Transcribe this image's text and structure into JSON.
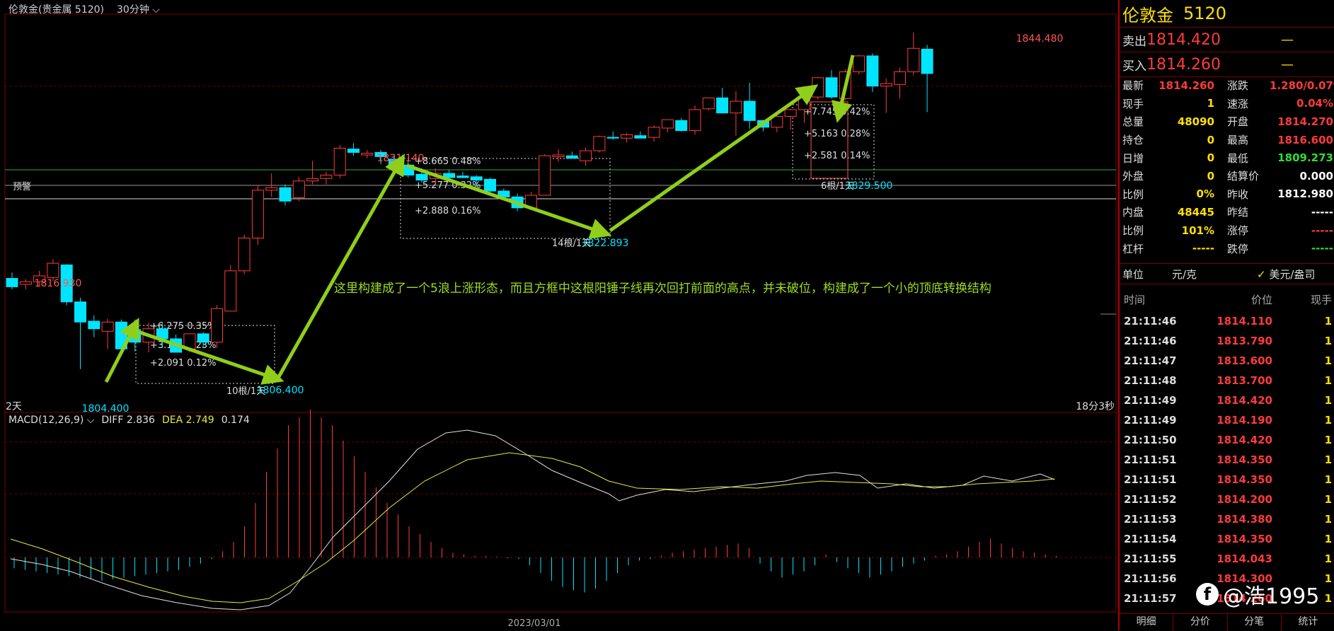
{
  "header": {
    "title": "伦敦金(贵金属 5120)",
    "interval": "30分钟"
  },
  "chart_data": {
    "type": "candlestick",
    "x_label": "2023/03/01",
    "duration_left": "2天",
    "duration_right": "18分3秒",
    "alert_label": "预警",
    "ylim": [
      1800.5,
      1846.5
    ],
    "candles": [
      [
        1815.2,
        1815.9,
        1813.9,
        1814.2
      ],
      [
        1814.5,
        1815.1,
        1813.9,
        1814.8
      ],
      [
        1814.8,
        1816.1,
        1814.2,
        1815.5
      ],
      [
        1815.3,
        1817.5,
        1814.9,
        1817.0
      ],
      [
        1816.8,
        1816.9,
        1812.0,
        1812.4
      ],
      [
        1812.4,
        1812.9,
        1804.4,
        1810.0
      ],
      [
        1810.1,
        1810.8,
        1808.2,
        1809.2
      ],
      [
        1808.9,
        1810.4,
        1806.8,
        1810.0
      ],
      [
        1810.0,
        1810.3,
        1806.5,
        1806.8
      ],
      [
        1809.1,
        1810.3,
        1806.5,
        1807.6
      ],
      [
        1807.6,
        1809.9,
        1806.4,
        1809.2
      ],
      [
        1809.2,
        1809.9,
        1806.9,
        1808.0
      ],
      [
        1808.0,
        1808.5,
        1806.4,
        1806.4
      ],
      [
        1806.8,
        1808.6,
        1806.4,
        1808.6
      ],
      [
        1808.6,
        1808.8,
        1806.9,
        1807.6
      ],
      [
        1807.6,
        1812.0,
        1806.9,
        1811.6
      ],
      [
        1811.3,
        1816.8,
        1811.3,
        1816.1
      ],
      [
        1816.1,
        1820.4,
        1815.7,
        1820.0
      ],
      [
        1820.0,
        1826.3,
        1819.2,
        1825.7
      ],
      [
        1825.7,
        1827.7,
        1824.9,
        1826.0
      ],
      [
        1826.0,
        1826.4,
        1823.9,
        1824.4
      ],
      [
        1824.8,
        1827.3,
        1824.4,
        1826.8
      ],
      [
        1826.8,
        1829.2,
        1826.4,
        1827.1
      ],
      [
        1827.1,
        1827.9,
        1826.4,
        1827.5
      ],
      [
        1827.5,
        1831.1,
        1827.1,
        1830.7
      ],
      [
        1830.6,
        1831.3,
        1829.8,
        1830.2
      ],
      [
        1829.9,
        1830.5,
        1829.5,
        1830.1
      ],
      [
        1830.2,
        1830.5,
        1828.8,
        1829.7
      ],
      [
        1829.4,
        1830.0,
        1828.6,
        1828.7
      ],
      [
        1828.7,
        1829.3,
        1827.2,
        1827.5
      ],
      [
        1827.6,
        1828.3,
        1826.6,
        1826.9
      ],
      [
        1827.1,
        1828.3,
        1826.3,
        1827.7
      ],
      [
        1827.7,
        1828.1,
        1826.6,
        1827.2
      ],
      [
        1827.4,
        1827.9,
        1827.2,
        1827.2
      ],
      [
        1827.3,
        1827.5,
        1826.1,
        1826.9
      ],
      [
        1827.0,
        1827.2,
        1825.4,
        1825.6
      ],
      [
        1825.6,
        1825.9,
        1824.8,
        1824.9
      ],
      [
        1824.9,
        1825.3,
        1823.2,
        1823.6
      ],
      [
        1823.6,
        1825.5,
        1823.6,
        1825.1
      ],
      [
        1825.1,
        1830.0,
        1825.1,
        1829.8
      ],
      [
        1829.7,
        1830.6,
        1829.1,
        1829.9
      ],
      [
        1829.8,
        1830.3,
        1829.5,
        1829.5
      ],
      [
        1829.2,
        1830.8,
        1828.6,
        1830.4
      ],
      [
        1830.4,
        1832.2,
        1830.2,
        1832.1
      ],
      [
        1832.0,
        1832.7,
        1831.7,
        1831.9
      ],
      [
        1831.9,
        1832.5,
        1831.4,
        1832.3
      ],
      [
        1832.2,
        1832.7,
        1831.9,
        1831.9
      ],
      [
        1832.0,
        1833.4,
        1831.5,
        1833.2
      ],
      [
        1833.1,
        1834.1,
        1832.6,
        1834.1
      ],
      [
        1834.0,
        1834.3,
        1832.7,
        1832.8
      ],
      [
        1832.8,
        1835.8,
        1832.3,
        1835.3
      ],
      [
        1835.4,
        1836.7,
        1835.2,
        1836.7
      ],
      [
        1836.7,
        1837.9,
        1834.9,
        1834.9
      ],
      [
        1834.9,
        1837.5,
        1832.2,
        1836.3
      ],
      [
        1836.3,
        1838.5,
        1833.0,
        1834.0
      ],
      [
        1834.0,
        1834.1,
        1832.7,
        1833.2
      ],
      [
        1833.2,
        1835.0,
        1832.6,
        1834.5
      ],
      [
        1834.5,
        1835.4,
        1832.9,
        1835.3
      ],
      [
        1835.3,
        1836.9,
        1833.7,
        1836.8
      ],
      [
        1836.8,
        1839.2,
        1836.5,
        1839.1
      ],
      [
        1839.1,
        1840.0,
        1836.6,
        1836.8
      ],
      [
        1836.6,
        1840.1,
        1836.4,
        1839.8
      ],
      [
        1839.8,
        1841.8,
        1839.5,
        1841.7
      ],
      [
        1841.7,
        1842.0,
        1837.4,
        1838.1
      ],
      [
        1838.1,
        1839.0,
        1834.9,
        1838.4
      ],
      [
        1838.3,
        1840.3,
        1836.6,
        1839.8
      ],
      [
        1839.8,
        1844.5,
        1839.4,
        1842.6
      ],
      [
        1842.5,
        1843.0,
        1835.0,
        1839.6
      ]
    ],
    "price_labels": {
      "high_1": "1816.930",
      "low_1": "1804.400",
      "high_2": "1831.140",
      "high_3": "1844.480",
      "low_box1": "1806.400",
      "low_box2": "1822.893",
      "low_box3": "1829.500"
    },
    "boxes": [
      {
        "lines": [
          "+6.275  0.35%",
          "+3.181  0.23%",
          "+2.091  0.12%"
        ],
        "count": "10根/1天"
      },
      {
        "lines": [
          "+8.665  0.48%",
          "+5.277  0.32%",
          "+2.888  0.16%"
        ],
        "count": "14根/1天"
      },
      {
        "lines": [
          "+7.745  0.42%",
          "+5.163  0.28%",
          "+2.581  0.14%"
        ],
        "count": "6根/1天"
      }
    ],
    "annotation": "这里构建成了一个5浪上涨形态，而且方框中这根阳锤子线再次回打前面的高点，并未破位，构建成了一个小的顶底转换结构",
    "macd": {
      "name": "MACD(12,26,9)",
      "diff_label": "DIFF",
      "diff": "2.836",
      "dea_label": "DEA",
      "dea": "2.749",
      "macd": "0.174"
    },
    "colors": {
      "up": "#ff3b3b",
      "down": "#00e5ff",
      "diff": "#e0e0e0",
      "dea": "#e8e840",
      "arrow": "#8fcf1a",
      "grid": "#7a0000"
    }
  },
  "quote": {
    "name": "伦敦金",
    "code": "5120",
    "sell_label": "卖出",
    "sell": "1814.420",
    "sell_mark": "—",
    "buy_label": "买入",
    "buy": "1814.260",
    "buy_mark": "—",
    "stats": [
      {
        "l1": "最新",
        "v1": "1814.260",
        "c1": "#ff3b3b",
        "l2": "涨跌",
        "v2": "1.280/0.07%",
        "c2": "#ff3b3b"
      },
      {
        "l1": "现手",
        "v1": "1",
        "c1": "#ffe000",
        "l2": "速涨",
        "v2": "0.04%",
        "c2": "#ff3b3b"
      },
      {
        "l1": "总量",
        "v1": "48090",
        "c1": "#ffe000",
        "l2": "开盘",
        "v2": "1814.270",
        "c2": "#ff3b3b"
      },
      {
        "l1": "持仓",
        "v1": "0",
        "c1": "#ffe000",
        "l2": "最高",
        "v2": "1816.600",
        "c2": "#ff3b3b"
      },
      {
        "l1": "日增",
        "v1": "0",
        "c1": "#ffe000",
        "l2": "最低",
        "v2": "1809.273",
        "c2": "#33dd33"
      },
      {
        "l1": "外盘",
        "v1": "0",
        "c1": "#ffe000",
        "l2": "结算价",
        "v2": "0.000",
        "c2": "#ffffff"
      },
      {
        "l1": "比例",
        "v1": "0%",
        "c1": "#ffe000",
        "l2": "昨收",
        "v2": "1812.980",
        "c2": "#ffffff"
      },
      {
        "l1": "内盘",
        "v1": "48445",
        "c1": "#ffe000",
        "l2": "昨结",
        "v2": "-----",
        "c2": "#ffffff"
      },
      {
        "l1": "比例",
        "v1": "101%",
        "c1": "#ffe000",
        "l2": "涨停",
        "v2": "-----",
        "c2": "#ff3b3b"
      },
      {
        "l1": "杠杆",
        "v1": "-----",
        "c1": "#ffe000",
        "l2": "跌停",
        "v2": "-----",
        "c2": "#33dd33"
      }
    ],
    "unit_label": "单位",
    "unit": "元/克",
    "unit_alt": "美元/盎司"
  },
  "ticks": {
    "head": {
      "time": "时间",
      "price": "价位",
      "qty": "现手"
    },
    "rows": [
      {
        "t": "21:11:46",
        "p": "1814.110",
        "q": "1"
      },
      {
        "t": "21:11:46",
        "p": "1813.790",
        "q": "1"
      },
      {
        "t": "21:11:47",
        "p": "1813.600",
        "q": "1"
      },
      {
        "t": "21:11:48",
        "p": "1813.700",
        "q": "1"
      },
      {
        "t": "21:11:49",
        "p": "1814.420",
        "q": "1"
      },
      {
        "t": "21:11:49",
        "p": "1814.190",
        "q": "1"
      },
      {
        "t": "21:11:50",
        "p": "1814.420",
        "q": "1"
      },
      {
        "t": "21:11:51",
        "p": "1814.350",
        "q": "1"
      },
      {
        "t": "21:11:51",
        "p": "1814.350",
        "q": "1"
      },
      {
        "t": "21:11:52",
        "p": "1814.200",
        "q": "1"
      },
      {
        "t": "21:11:53",
        "p": "1814.380",
        "q": "1"
      },
      {
        "t": "21:11:54",
        "p": "1814.350",
        "q": "1"
      },
      {
        "t": "21:11:55",
        "p": "1814.043",
        "q": "1"
      },
      {
        "t": "21:11:56",
        "p": "1814.300",
        "q": "1"
      },
      {
        "t": "21:11:57",
        "p": "1814.260",
        "q": "1"
      }
    ]
  },
  "tabs": [
    "明细",
    "分价",
    "分笔",
    "统计"
  ],
  "watermark": "@浩1995"
}
